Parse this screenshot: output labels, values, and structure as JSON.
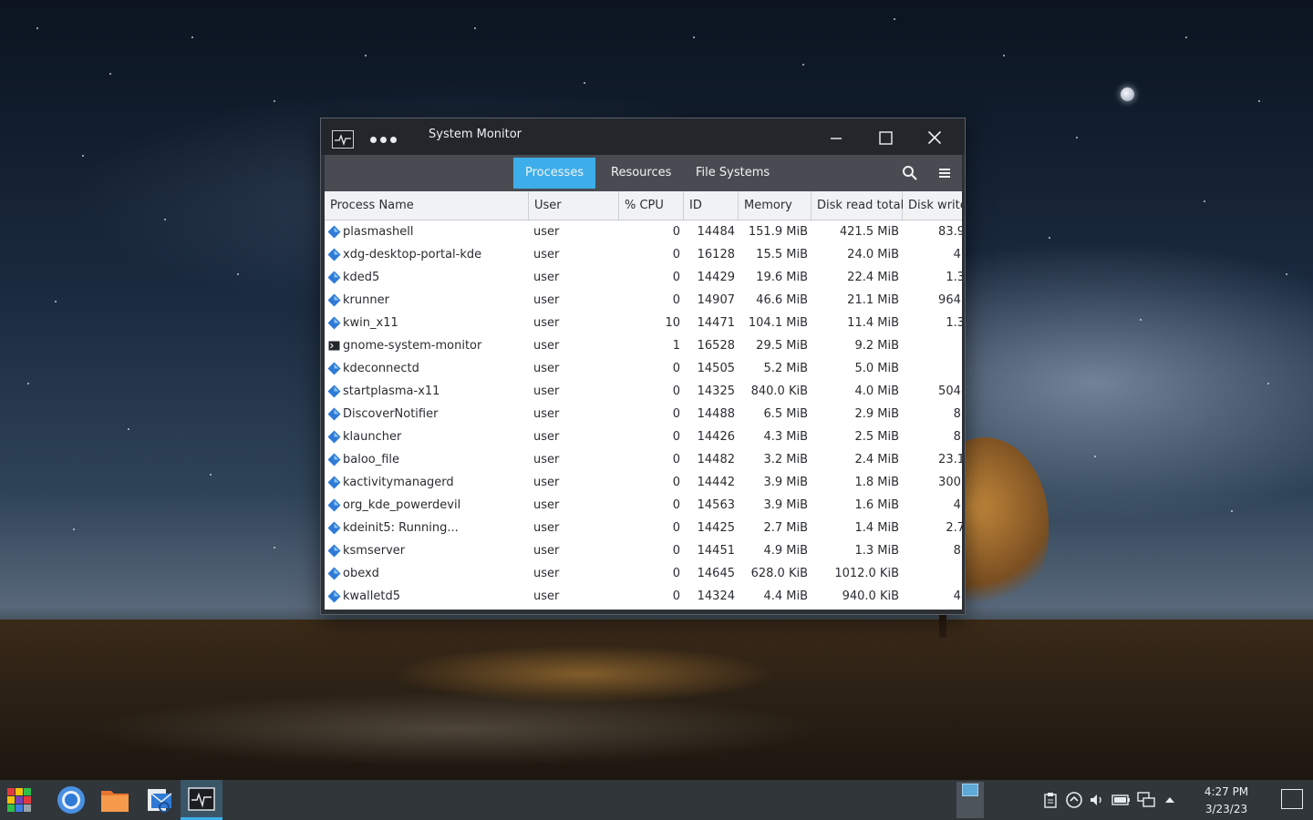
{
  "window": {
    "title": "System Monitor"
  },
  "toolbar": {
    "tabs": [
      {
        "label": "Processes",
        "active": true
      },
      {
        "label": "Resources",
        "active": false
      },
      {
        "label": "File Systems",
        "active": false
      }
    ],
    "search_icon": "search-icon",
    "menu_icon": "hamburger-menu-icon"
  },
  "table": {
    "columns": [
      "Process Name",
      "User",
      "% CPU",
      "ID",
      "Memory",
      "Disk read total",
      "Disk write"
    ],
    "rows": [
      {
        "name": "plasmashell",
        "user": "user",
        "cpu": "0",
        "id": "14484",
        "memory": "151.9 MiB",
        "read": "421.5 MiB",
        "write": "83.9",
        "icon": "kde-diamond-icon"
      },
      {
        "name": "xdg-desktop-portal-kde",
        "user": "user",
        "cpu": "0",
        "id": "16128",
        "memory": "15.5 MiB",
        "read": "24.0 MiB",
        "write": "4.",
        "icon": "kde-diamond-icon"
      },
      {
        "name": "kded5",
        "user": "user",
        "cpu": "0",
        "id": "14429",
        "memory": "19.6 MiB",
        "read": "22.4 MiB",
        "write": "1.3",
        "icon": "kde-diamond-icon"
      },
      {
        "name": "krunner",
        "user": "user",
        "cpu": "0",
        "id": "14907",
        "memory": "46.6 MiB",
        "read": "21.1 MiB",
        "write": "964.",
        "icon": "kde-diamond-icon"
      },
      {
        "name": "kwin_x11",
        "user": "user",
        "cpu": "10",
        "id": "14471",
        "memory": "104.1 MiB",
        "read": "11.4 MiB",
        "write": "1.3",
        "icon": "kde-diamond-icon"
      },
      {
        "name": "gnome-system-monitor",
        "user": "user",
        "cpu": "1",
        "id": "16528",
        "memory": "29.5 MiB",
        "read": "9.2 MiB",
        "write": "",
        "icon": "terminal-icon"
      },
      {
        "name": "kdeconnectd",
        "user": "user",
        "cpu": "0",
        "id": "14505",
        "memory": "5.2 MiB",
        "read": "5.0 MiB",
        "write": "",
        "icon": "kde-diamond-icon"
      },
      {
        "name": "startplasma-x11",
        "user": "user",
        "cpu": "0",
        "id": "14325",
        "memory": "840.0 KiB",
        "read": "4.0 MiB",
        "write": "504.",
        "icon": "kde-diamond-icon"
      },
      {
        "name": "DiscoverNotifier",
        "user": "user",
        "cpu": "0",
        "id": "14488",
        "memory": "6.5 MiB",
        "read": "2.9 MiB",
        "write": "8.",
        "icon": "kde-diamond-icon"
      },
      {
        "name": "klauncher",
        "user": "user",
        "cpu": "0",
        "id": "14426",
        "memory": "4.3 MiB",
        "read": "2.5 MiB",
        "write": "8.",
        "icon": "kde-diamond-icon"
      },
      {
        "name": "baloo_file",
        "user": "user",
        "cpu": "0",
        "id": "14482",
        "memory": "3.2 MiB",
        "read": "2.4 MiB",
        "write": "23.1",
        "icon": "kde-diamond-icon"
      },
      {
        "name": "kactivitymanagerd",
        "user": "user",
        "cpu": "0",
        "id": "14442",
        "memory": "3.9 MiB",
        "read": "1.8 MiB",
        "write": "300.",
        "icon": "kde-diamond-icon"
      },
      {
        "name": "org_kde_powerdevil",
        "user": "user",
        "cpu": "0",
        "id": "14563",
        "memory": "3.9 MiB",
        "read": "1.6 MiB",
        "write": "4.",
        "icon": "kde-diamond-icon"
      },
      {
        "name": "kdeinit5: Running...",
        "user": "user",
        "cpu": "0",
        "id": "14425",
        "memory": "2.7 MiB",
        "read": "1.4 MiB",
        "write": "2.7",
        "icon": "kde-diamond-icon"
      },
      {
        "name": "ksmserver",
        "user": "user",
        "cpu": "0",
        "id": "14451",
        "memory": "4.9 MiB",
        "read": "1.3 MiB",
        "write": "8.",
        "icon": "kde-diamond-icon"
      },
      {
        "name": "obexd",
        "user": "user",
        "cpu": "0",
        "id": "14645",
        "memory": "628.0 KiB",
        "read": "1012.0 KiB",
        "write": "",
        "icon": "kde-diamond-icon"
      },
      {
        "name": "kwalletd5",
        "user": "user",
        "cpu": "0",
        "id": "14324",
        "memory": "4.4 MiB",
        "read": "940.0 KiB",
        "write": "4.",
        "icon": "kde-diamond-icon"
      }
    ]
  },
  "taskbar": {
    "apps": [
      "application-launcher-icon",
      "chrome-icon",
      "folder-icon",
      "mail-icon",
      "system-monitor-icon"
    ],
    "tray": [
      "clipboard-icon",
      "update-icon",
      "volume-icon",
      "battery-icon",
      "network-icon",
      "expand-tray-icon"
    ],
    "clock": {
      "time": "4:27 PM",
      "date": "3/23/23"
    }
  },
  "colors": {
    "accent": "#3daee9",
    "titlebar": "#23262b",
    "toolbar": "#484c52",
    "taskbar": "#31363b"
  }
}
